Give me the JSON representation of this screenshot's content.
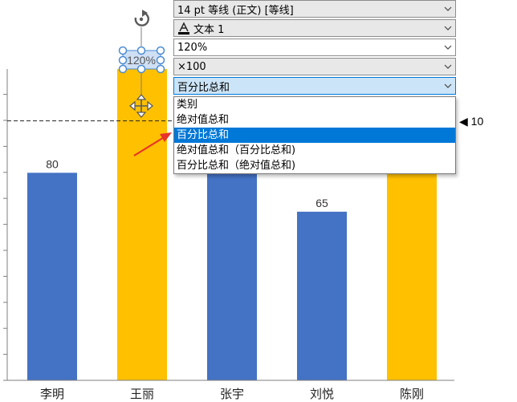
{
  "chart_data": {
    "type": "bar",
    "categories": [
      "李明",
      "王丽",
      "张宇",
      "刘悦",
      "陈刚"
    ],
    "values": [
      80,
      120,
      100,
      65,
      100
    ],
    "data_labels": [
      "80",
      "120%",
      "",
      "65",
      ""
    ],
    "colors": [
      "#4472c4",
      "#ffc000",
      "#4472c4",
      "#4472c4",
      "#ffc000"
    ],
    "title": "",
    "xlabel": "",
    "ylabel": "",
    "ylim": [
      0,
      120
    ],
    "grid": false,
    "reference_line": 100,
    "reference_label": "◀ 10"
  },
  "panel": {
    "font_combo": "14 pt 等线  (正文)  [等线]",
    "style_combo": "文本 1",
    "percent_combo": "120%",
    "multiplier_combo": "×100",
    "mode_combo": "百分比总和",
    "options": [
      "类别",
      "绝对值总和",
      "百分比总和",
      "绝对值总和（百分比总和)",
      "百分比总和（绝对值总和)"
    ],
    "selected_index": 2
  },
  "colors": {
    "accent": "#0078d7",
    "arrow": "#e8332a",
    "handle": "#4a8bd4"
  },
  "icons": [
    "rotate-icon",
    "move-icon",
    "chevron-down-icon",
    "font-color-icon",
    "red-pointer-arrow-icon"
  ]
}
